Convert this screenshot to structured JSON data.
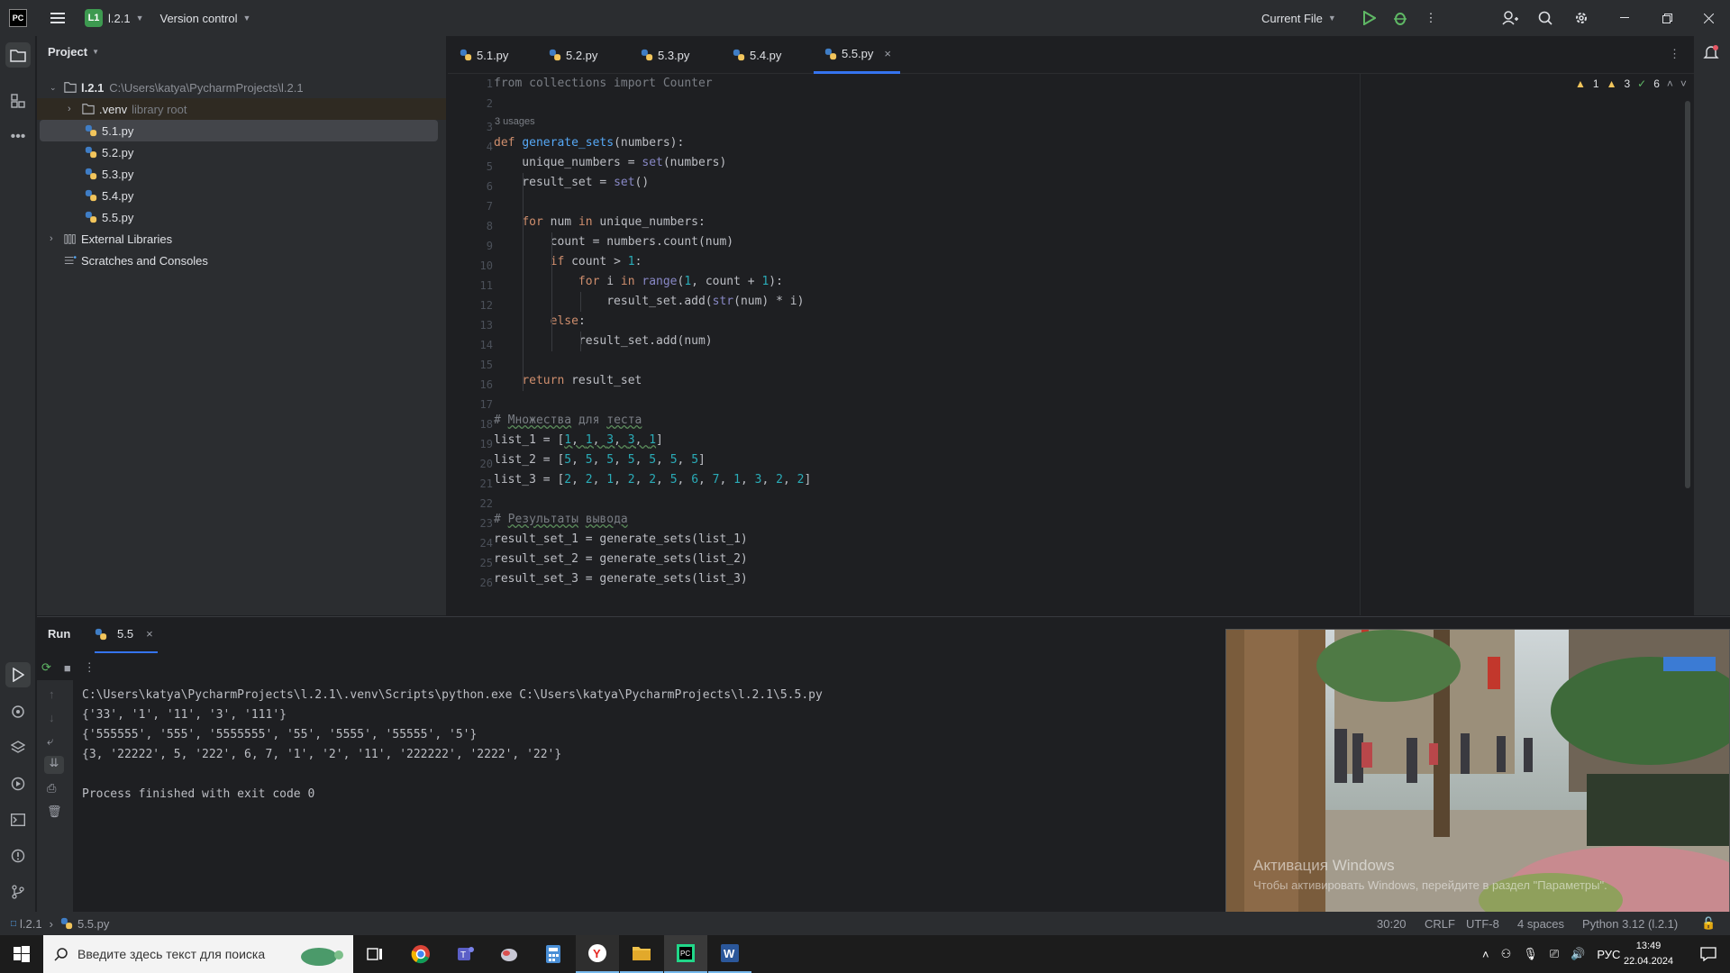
{
  "titlebar": {
    "project_badge": "L1",
    "project_name": "l.2.1",
    "version_control": "Version control",
    "run_config": "Current File"
  },
  "project_panel": {
    "header": "Project",
    "root_name": "l.2.1",
    "root_path": "C:\\Users\\katya\\PycharmProjects\\l.2.1",
    "venv": ".venv",
    "venv_hint": "library root",
    "files": [
      "5.1.py",
      "5.2.py",
      "5.3.py",
      "5.4.py",
      "5.5.py"
    ],
    "external_libraries": "External Libraries",
    "scratches": "Scratches and Consoles"
  },
  "tabs": [
    "5.1.py",
    "5.2.py",
    "5.3.py",
    "5.4.py",
    "5.5.py"
  ],
  "inspections": {
    "warn1": "1",
    "warn2": "3",
    "ok": "6"
  },
  "editor": {
    "usages_hint": "3 usages",
    "line_numbers": [
      "1",
      "2",
      "3",
      "4",
      "5",
      "6",
      "7",
      "8",
      "9",
      "10",
      "11",
      "12",
      "13",
      "14",
      "15",
      "16",
      "17",
      "18",
      "19",
      "20",
      "21",
      "22",
      "23",
      "24",
      "25",
      "26"
    ]
  },
  "run_panel": {
    "tab_run": "Run",
    "tab_config": "5.5",
    "output": [
      "C:\\Users\\katya\\PycharmProjects\\l.2.1\\.venv\\Scripts\\python.exe C:\\Users\\katya\\PycharmProjects\\l.2.1\\5.5.py",
      "{'33', '1', '11', '3', '111'}",
      "{'555555', '555', '5555555', '55', '5555', '55555', '5'}",
      "{3, '22222', 5, '222', 6, 7, '1', '2', '11', '222222', '2222', '22'}",
      "",
      "Process finished with exit code 0"
    ]
  },
  "video_overlay": {
    "line1": "Активация Windows",
    "line2": "Чтобы активировать Windows, перейдите в раздел \"Параметры\"."
  },
  "statusbar": {
    "crumb_project": "l.2.1",
    "crumb_file": "5.5.py",
    "position": "30:20",
    "line_sep": "CRLF",
    "encoding": "UTF-8",
    "indent": "4 spaces",
    "interpreter": "Python 3.12 (l.2.1)"
  },
  "taskbar": {
    "search_placeholder": "Введите здесь текст для поиска",
    "lang": "РУС",
    "time": "13:49",
    "date": "22.04.2024"
  },
  "colors": {
    "accent": "#3574f0",
    "keyword": "#cf8e6d",
    "function": "#56a8f5",
    "number": "#2aacb8"
  }
}
